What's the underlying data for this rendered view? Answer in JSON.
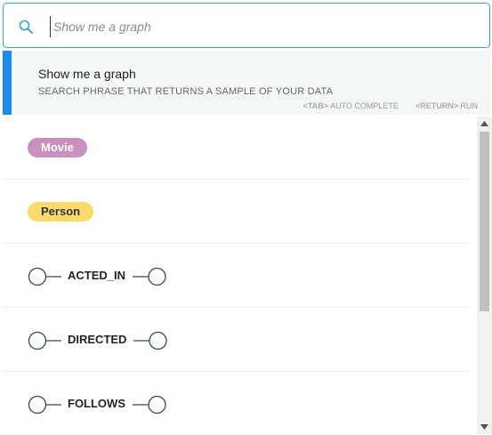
{
  "search": {
    "placeholder": "Show me a graph",
    "value": ""
  },
  "suggestion": {
    "title": "Show me a graph",
    "description": "SEARCH PHRASE THAT RETURNS A SAMPLE OF YOUR DATA"
  },
  "hints": {
    "tab_key": "<TAB>",
    "tab_action": "AUTO COMPLETE",
    "return_key": "<RETURN>",
    "return_action": "RUN"
  },
  "items": [
    {
      "type": "node",
      "label": "Movie",
      "color": "#c990c0"
    },
    {
      "type": "node",
      "label": "Person",
      "color": "#fcda6c"
    },
    {
      "type": "relationship",
      "label": "ACTED_IN"
    },
    {
      "type": "relationship",
      "label": "DIRECTED"
    },
    {
      "type": "relationship",
      "label": "FOLLOWS"
    }
  ],
  "colors": {
    "accent": "#1a8cf0",
    "search_border": "#2f9fd6",
    "relationship_stroke": "#2c4a52"
  }
}
